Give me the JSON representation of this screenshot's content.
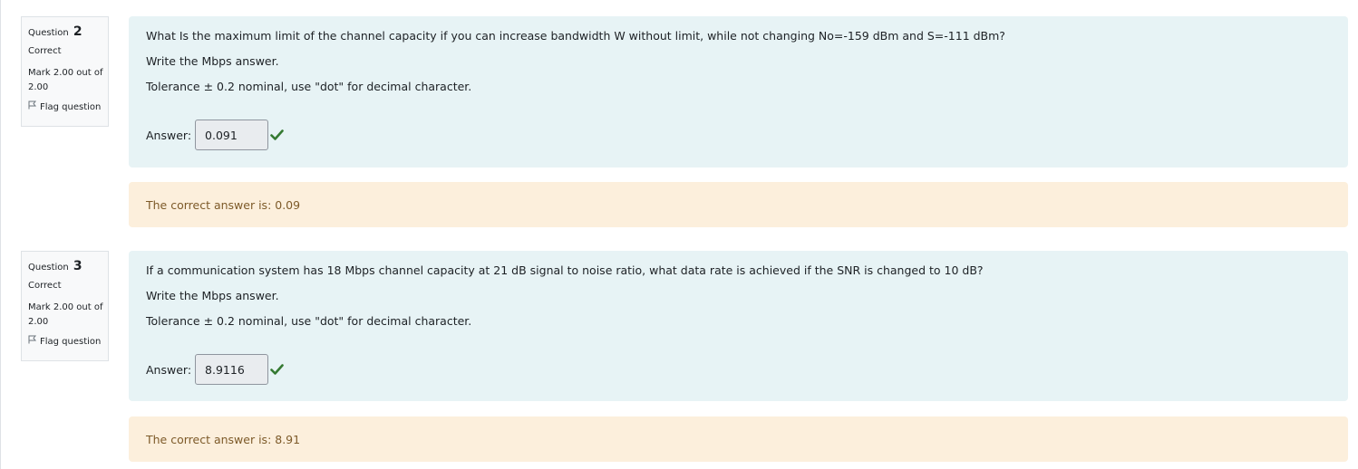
{
  "questions": [
    {
      "label": "Question",
      "number": "2",
      "state": "Correct",
      "grade": "Mark 2.00 out of 2.00",
      "flag_label": "Flag question",
      "text": "What Is the maximum limit of the channel capacity if you can increase bandwidth W without limit, while not changing No=-159 dBm and S=-111 dBm?",
      "instruction": "Write the Mbps answer.",
      "tolerance": "Tolerance ± 0.2 nominal, use \"dot\" for decimal character.",
      "answer_label": "Answer:",
      "answer_value": "0.091",
      "right_answer": "The correct answer is: 0.09"
    },
    {
      "label": "Question",
      "number": "3",
      "state": "Correct",
      "grade": "Mark 2.00 out of 2.00",
      "flag_label": "Flag question",
      "text": "If a communication system has 18 Mbps channel capacity at 21 dB signal to noise ratio, what data rate is achieved if the SNR is changed to 10 dB?",
      "instruction": "Write the Mbps answer.",
      "tolerance": "Tolerance ± 0.2 nominal, use \"dot\" for decimal character.",
      "answer_label": "Answer:",
      "answer_value": "8.9116",
      "right_answer": "The correct answer is: 8.91"
    }
  ],
  "colors": {
    "formulation_bg": "#e7f3f5",
    "outcome_bg": "#fcefdc",
    "outcome_text": "#7d5a29",
    "correct_check": "#357a32"
  }
}
